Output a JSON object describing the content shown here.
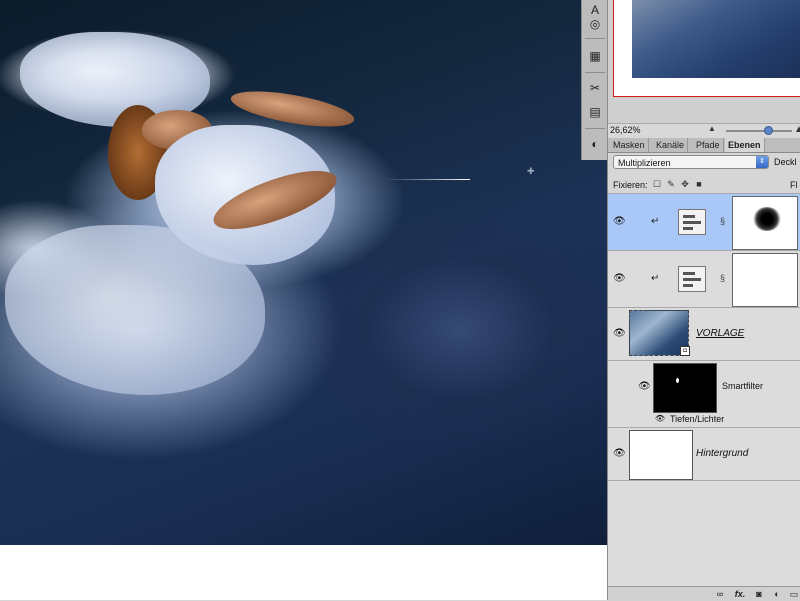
{
  "navigator": {
    "zoom_value": "26,62%"
  },
  "layers_panel": {
    "tabs": [
      {
        "label": "Masken",
        "active": false
      },
      {
        "label": "Kanäle",
        "active": false
      },
      {
        "label": "Pfade",
        "active": false
      },
      {
        "label": "Ebenen",
        "active": true
      }
    ],
    "blend_mode": "Multiplizieren",
    "opacity_label": "Deckl",
    "lock_label": "Fixieren:",
    "fill_label": "Fl",
    "layers": [
      {
        "type": "adjustment",
        "selected": true,
        "mask": "black-blot"
      },
      {
        "type": "adjustment",
        "selected": false,
        "mask": "white"
      },
      {
        "type": "smart-object",
        "name": "VORLAGE"
      },
      {
        "type": "smart-filters",
        "name": "Smartfilter"
      },
      {
        "type": "filter",
        "name": "Tiefen/Lichter"
      },
      {
        "type": "background",
        "name": "Hintergrund"
      }
    ],
    "bottom_icons": [
      "link-icon",
      "fx-icon",
      "add-mask-icon",
      "adjustment-icon",
      "new-group-icon"
    ],
    "fx_label": "fx."
  },
  "colors": {
    "selection": "#a9c8f7",
    "nav_frame_border": "#d31b1b",
    "blend_arrow": "#3468c4"
  }
}
